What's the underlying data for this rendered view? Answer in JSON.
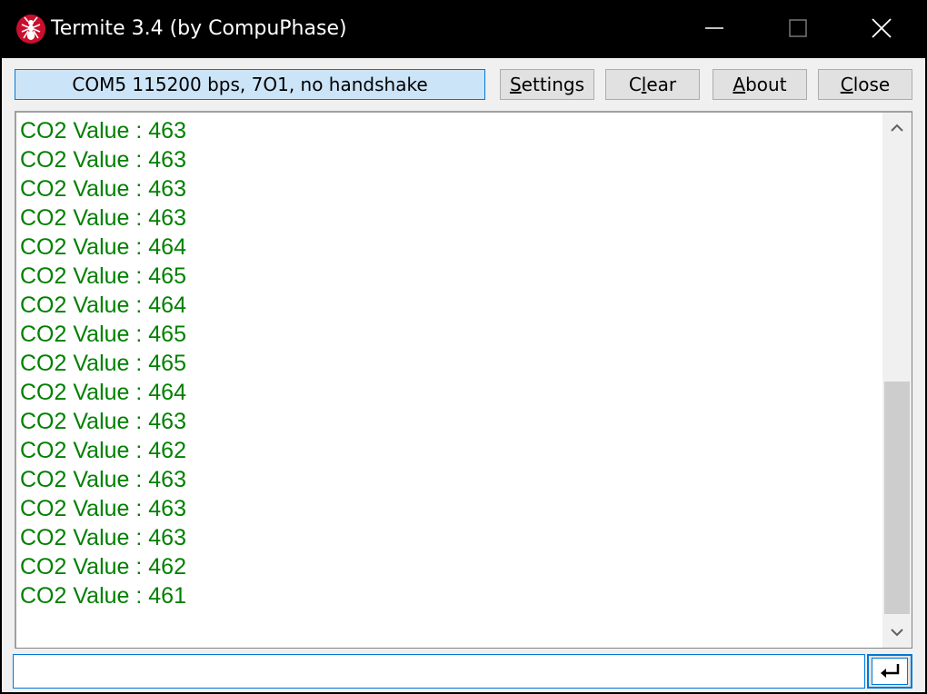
{
  "window": {
    "title": "Termite 3.4 (by CompuPhase)",
    "icon": "ant-icon"
  },
  "toolbar": {
    "status": "COM5 115200 bps, 7O1, no handshake",
    "settings_prefix": "",
    "settings_accel": "S",
    "settings_rest": "ettings",
    "clear_prefix": "C",
    "clear_accel": "l",
    "clear_rest": "ear",
    "about_prefix": "",
    "about_accel": "A",
    "about_rest": "bout",
    "close_prefix": "",
    "close_accel": "C",
    "close_rest": "lose"
  },
  "terminal": {
    "text_color": "#008000",
    "lines": [
      "CO2 Value : 463",
      "CO2 Value : 463",
      "CO2 Value : 463",
      "CO2 Value : 463",
      "CO2 Value : 464",
      "CO2 Value : 465",
      "CO2 Value : 464",
      "CO2 Value : 465",
      "CO2 Value : 465",
      "CO2 Value : 464",
      "CO2 Value : 463",
      "CO2 Value : 462",
      "CO2 Value : 463",
      "CO2 Value : 463",
      "CO2 Value : 463",
      "CO2 Value : 462",
      "CO2 Value : 461"
    ]
  },
  "input": {
    "value": ""
  },
  "colors": {
    "accent": "#0078d7",
    "status_bg": "#cce4f7",
    "icon_red": "#c8102e"
  }
}
